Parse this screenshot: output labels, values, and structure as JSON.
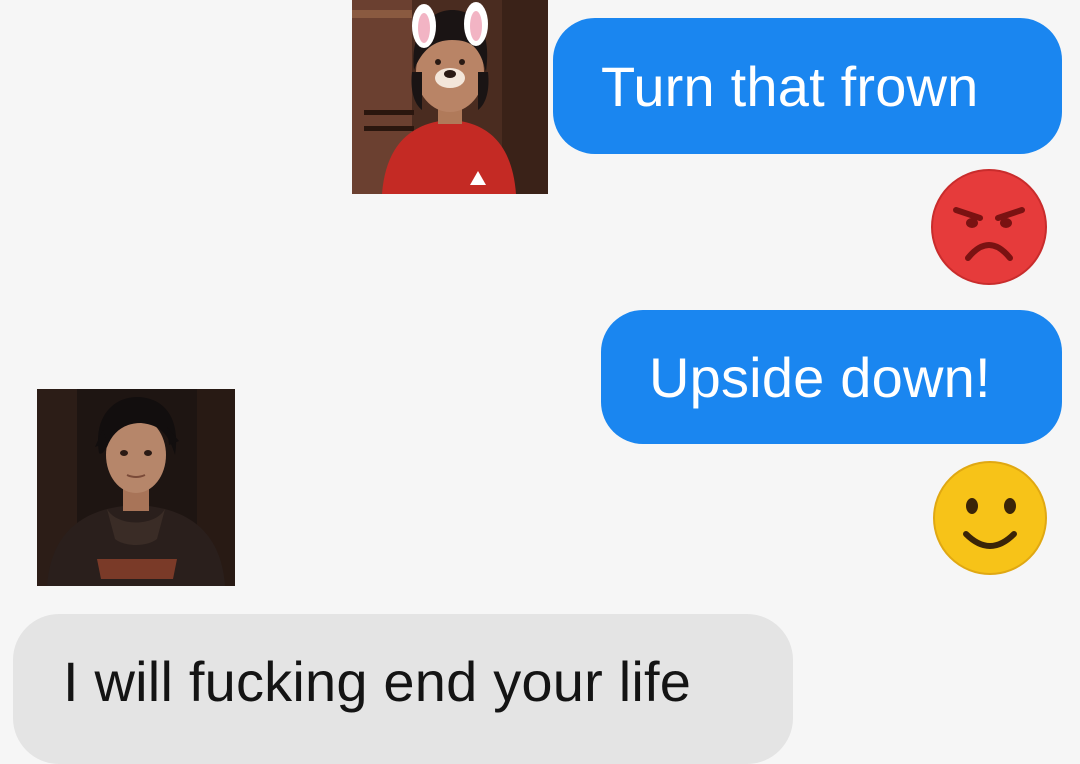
{
  "conversation": {
    "messages": [
      {
        "sender": "self",
        "text": "Turn that frown"
      },
      {
        "sender": "self",
        "text": "Upside down!"
      },
      {
        "sender": "other",
        "text": "I will fucking end your life"
      }
    ],
    "emojis": [
      {
        "icon": "angry-face-icon",
        "color": "#e63b3b"
      },
      {
        "icon": "smiling-face-icon",
        "color": "#f7c318"
      }
    ],
    "avatars": [
      {
        "icon": "avatar-bunny-filter-kid"
      },
      {
        "icon": "avatar-hooded-teen"
      }
    ]
  },
  "colors": {
    "background": "#f6f6f6",
    "outgoing_bubble": "#1a86f0",
    "incoming_bubble": "#e4e4e4"
  }
}
